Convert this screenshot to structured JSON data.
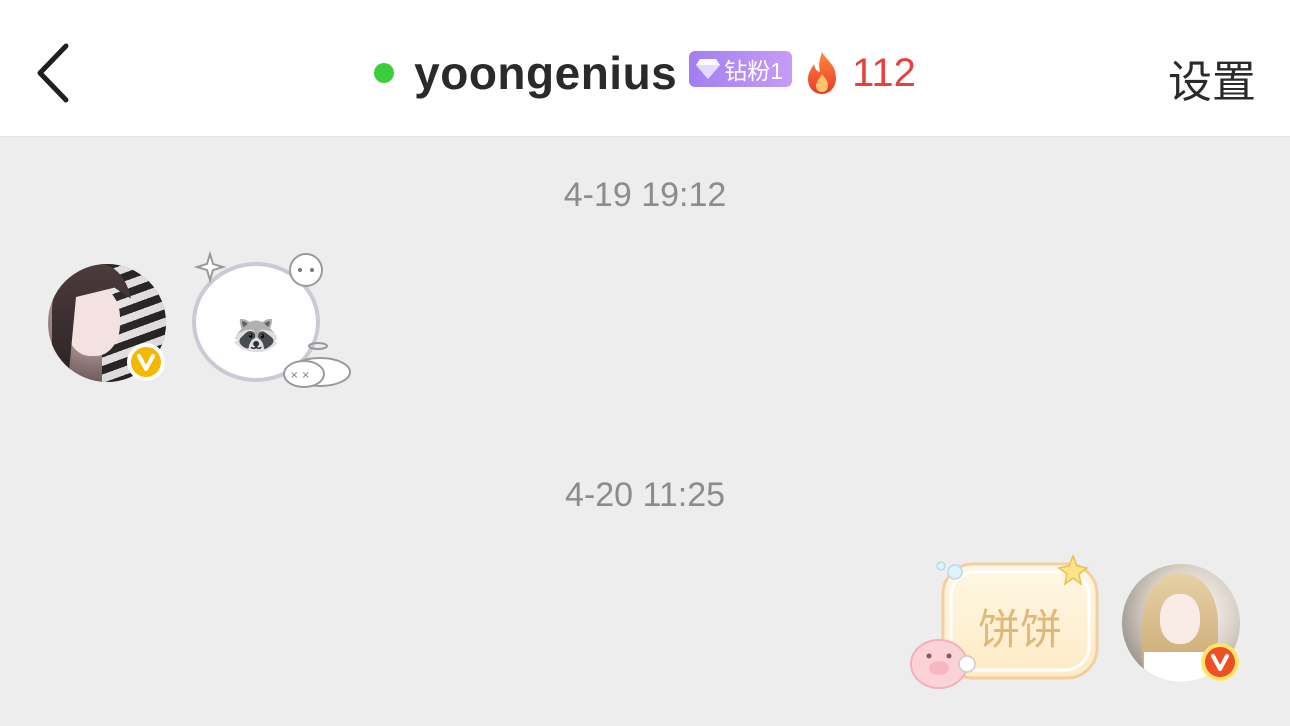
{
  "header": {
    "back_icon": "chevron-left-icon",
    "username": "yoongenius",
    "online_status_color": "#3dcc3a",
    "fan_badge_label": "钻粉1",
    "fan_badge_icon": "diamond-icon",
    "streak_icon": "fire-icon",
    "streak_count": "112",
    "settings_label": "设置"
  },
  "messages": [
    {
      "timestamp": "4-19 19:12",
      "side": "left",
      "type": "sticker",
      "emoji": "🦝",
      "verified_badge_color": "#f5b800"
    },
    {
      "timestamp": "4-20 11:25",
      "side": "right",
      "type": "text-sticker",
      "text": "饼饼",
      "verified_badge_color": "#f04e23"
    }
  ],
  "colors": {
    "background": "#ededed",
    "header_bg": "#ffffff",
    "streak_red": "#e8403e",
    "fan_badge_purple": "#a17ff1"
  }
}
